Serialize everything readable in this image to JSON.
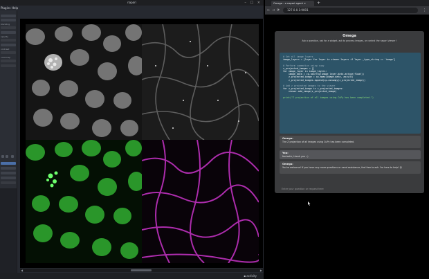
{
  "napari": {
    "title": "napari",
    "window_controls": "– □ ×",
    "menus": [
      "Plugins",
      "Help"
    ],
    "left_labels": [
      "blending",
      "opacity",
      "contrast",
      "colormap"
    ],
    "home_icon": "home-icon",
    "scroll_left": "◀",
    "scroll_right": "▶",
    "activity": "▪ activity"
  },
  "browser": {
    "tab_title": "Omega - a napari agent ×",
    "tab_close": "×",
    "new_tab": "+",
    "nav": [
      "←",
      "→",
      "⟳"
    ],
    "url": "127.0.0.1:9001",
    "menu_icon": "⋮"
  },
  "chat": {
    "title": "Omega",
    "subtitle": "Ask a question, ask for a widget, ask to process images, or control the napari viewer !",
    "code_lines": [
      {
        "t": "c-comment",
        "s": "# Get all image layers"
      },
      {
        "t": "c-code",
        "s": "image_layers = [layer for layer in viewer.layers if layer._type_string == 'image']"
      },
      {
        "t": "c-blank",
        "s": ""
      },
      {
        "t": "c-comment",
        "s": "# Perform summation using cupy"
      },
      {
        "t": "c-code",
        "s": "z_projected_images = []"
      },
      {
        "t": "c-code",
        "s": "for image_layer in image_layers:"
      },
      {
        "t": "c-code",
        "s": "    image_data = cp.asarray(image_layer.data.astype(float))"
      },
      {
        "t": "c-code",
        "s": "    z_projected_image = cp.amax(image_data, axis=0)"
      },
      {
        "t": "c-code",
        "s": "    z_projected_images.append(cp.asnumpy(z_projected_image))"
      },
      {
        "t": "c-blank",
        "s": ""
      },
      {
        "t": "c-comment",
        "s": "# Add z projected images to the viewer"
      },
      {
        "t": "c-code",
        "s": "for z_projected_image in z_projected_images:"
      },
      {
        "t": "c-code",
        "s": "    viewer.add_image(z_projected_image)"
      },
      {
        "t": "c-blank",
        "s": ""
      },
      {
        "t": "c-str",
        "s": "print(\"Z projection of all images using CuPy has been completed.\")"
      }
    ],
    "messages": [
      {
        "speaker": "Omega:",
        "text": "The Z projection of all images using CuPy has been completed."
      },
      {
        "speaker": "You:",
        "text": "fantastic, thank you :-)"
      },
      {
        "speaker": "Omega:",
        "text": "You're welcome! If you have any more questions or need assistance, feel free to ask. I'm here to help! 😊"
      }
    ],
    "input_placeholder": "Enter your question or request here"
  }
}
